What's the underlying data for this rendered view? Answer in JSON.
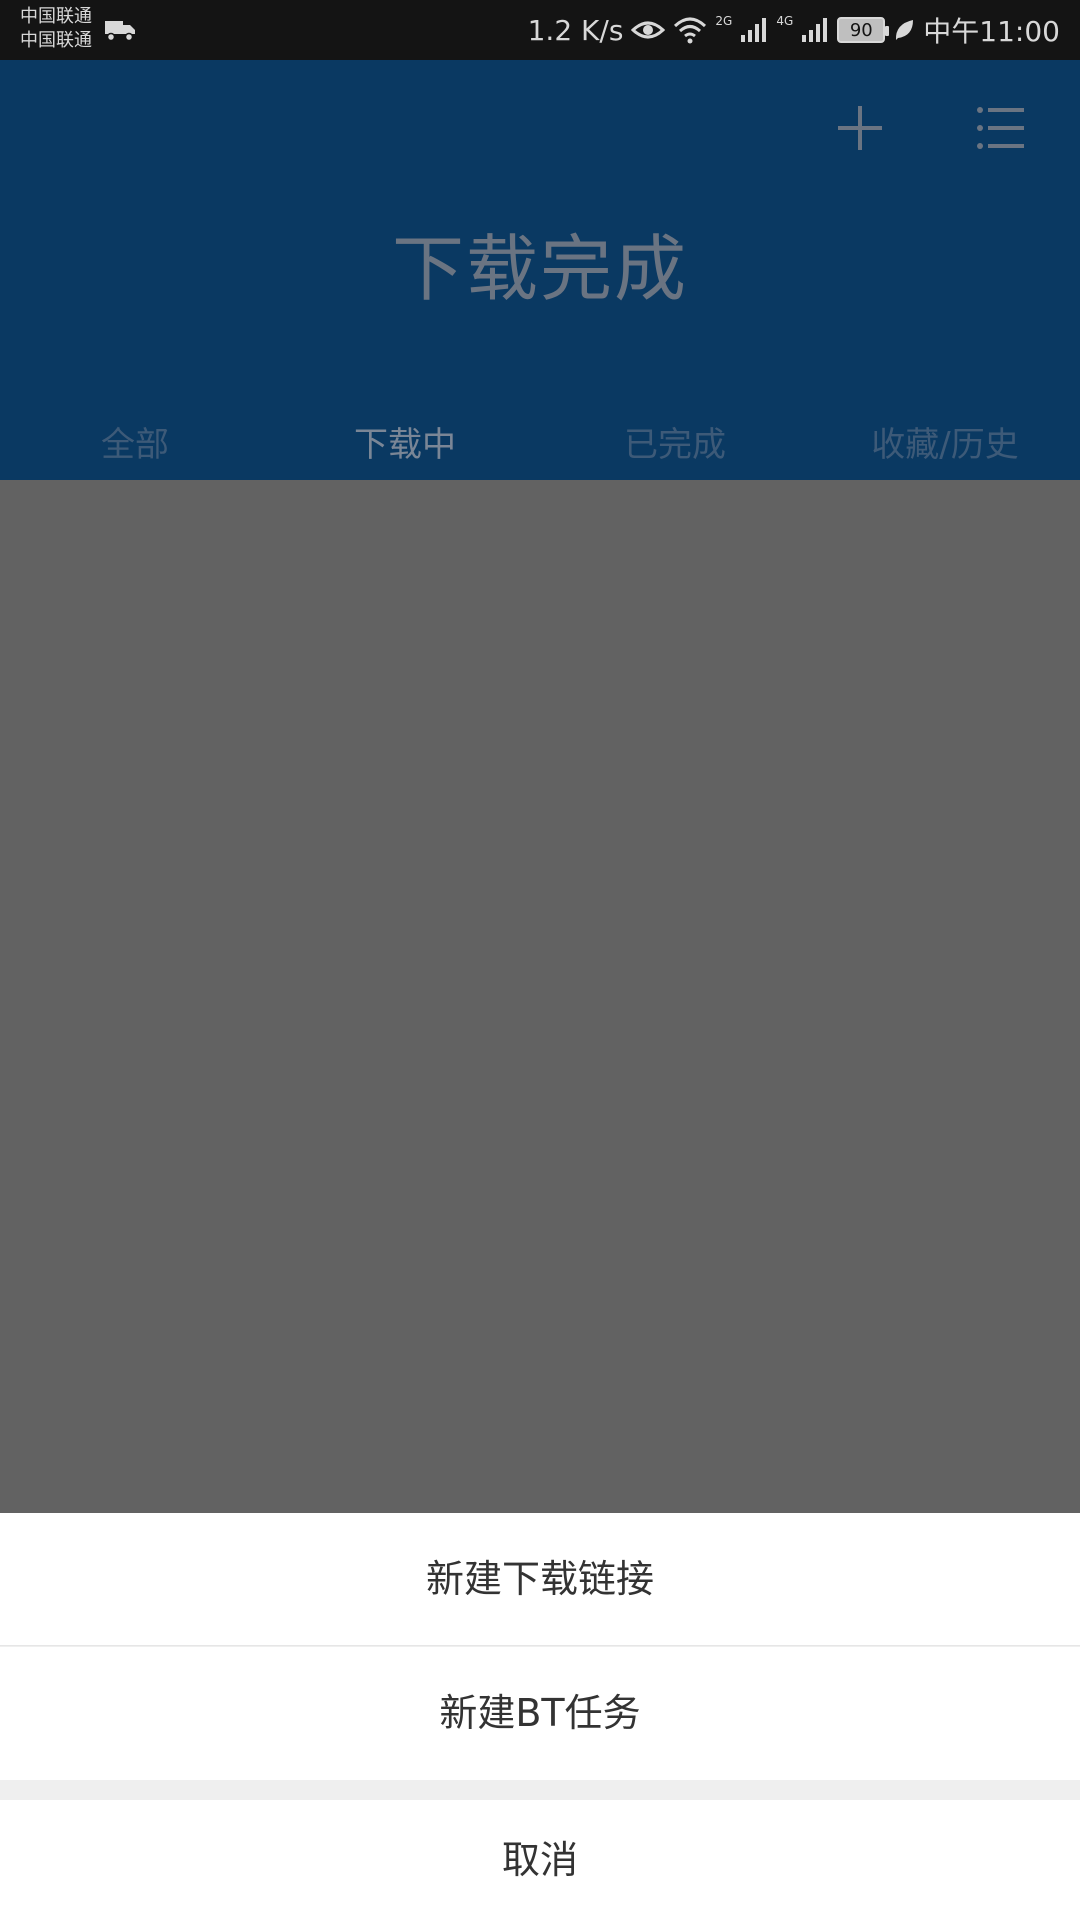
{
  "status_bar": {
    "carrier_1": "中国联通",
    "carrier_2": "中国联通",
    "speed": "1.2 K/s",
    "net_1": "2G",
    "net_2": "4G",
    "battery": "90",
    "time": "中午11:00"
  },
  "header": {
    "title": "下载完成",
    "tabs": [
      {
        "label": "全部"
      },
      {
        "label": "下载中"
      },
      {
        "label": "已完成"
      },
      {
        "label": "收藏/历史"
      }
    ],
    "active_tab": "下载中"
  },
  "sheet": {
    "new_link": "新建下载链接",
    "new_bt": "新建BT任务",
    "cancel": "取消"
  },
  "colors": {
    "header_bg": "#0a3962",
    "overlay": "#626262",
    "sheet_bg": "#ffffff"
  }
}
